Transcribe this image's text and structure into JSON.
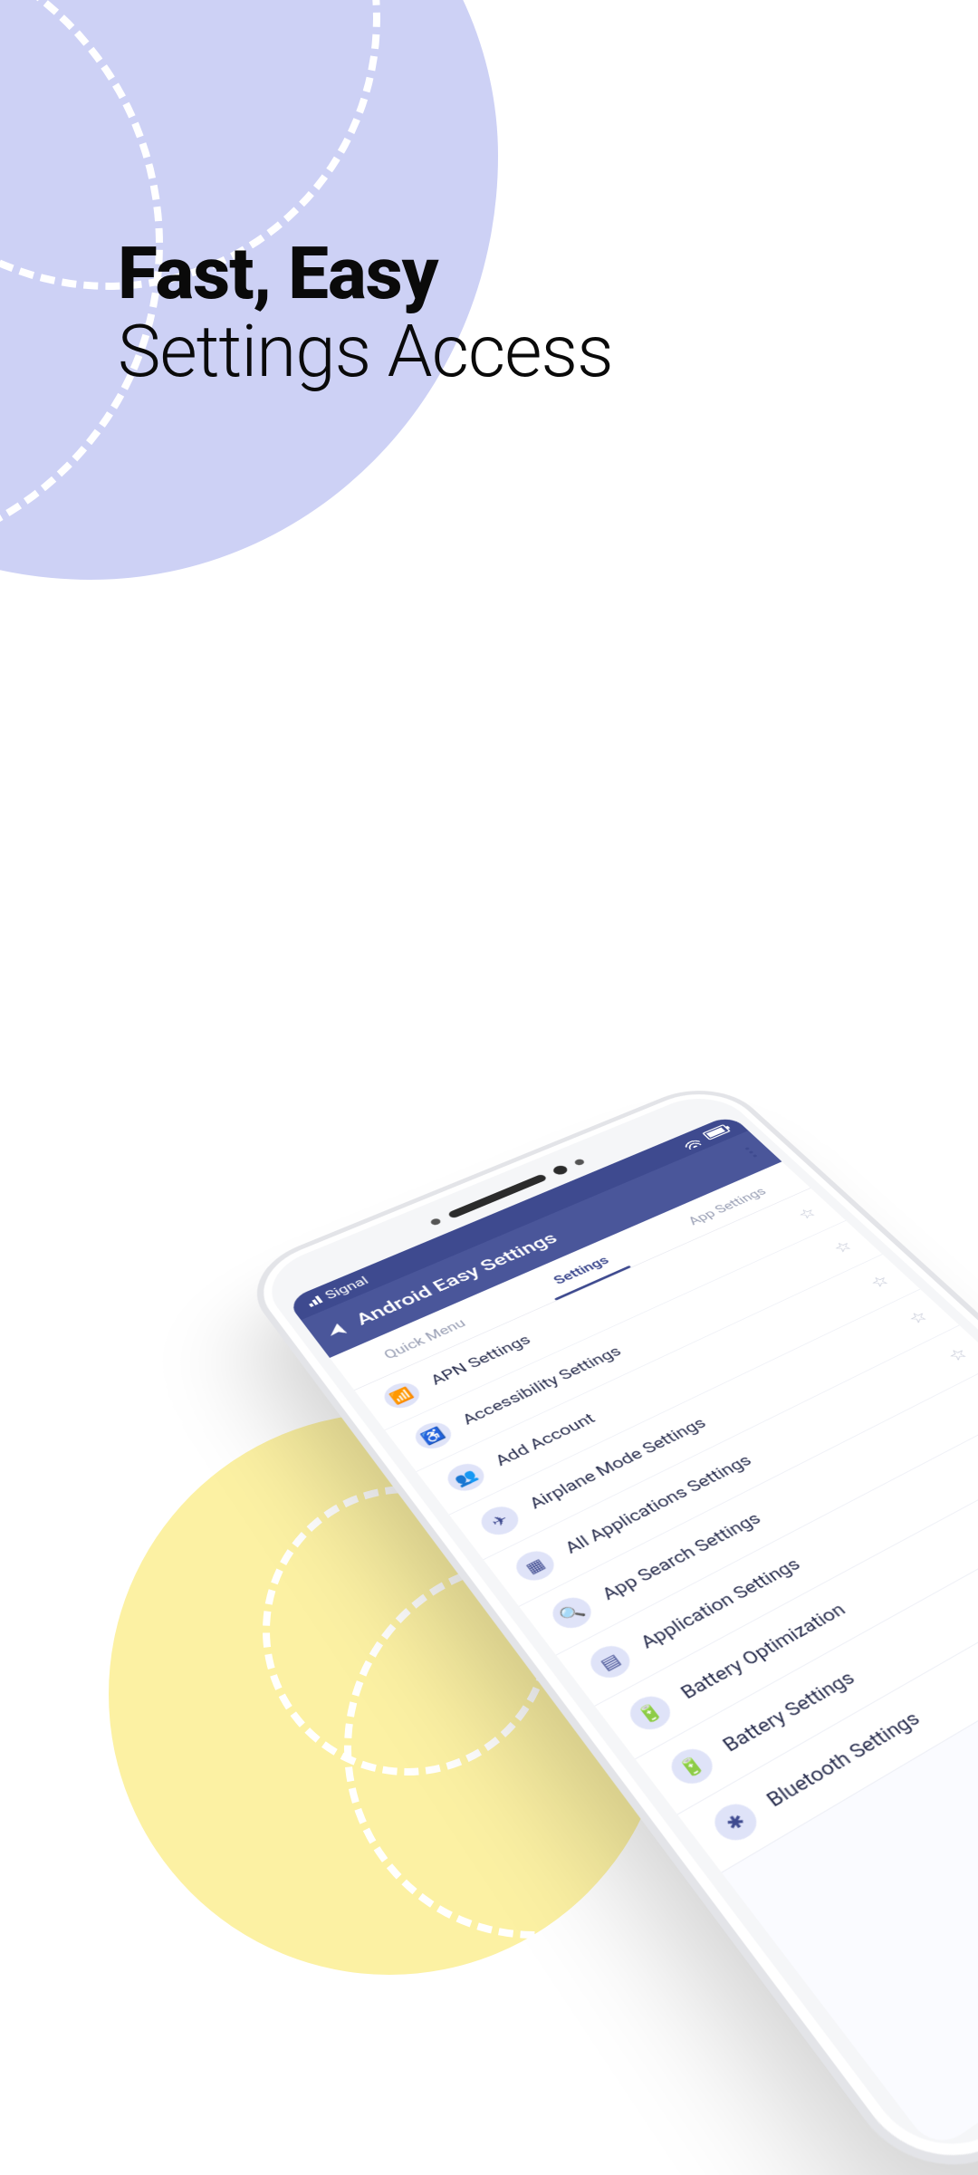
{
  "headline": {
    "bold": "Fast, Easy",
    "light": "Settings Access"
  },
  "status": {
    "signal_label": "Signal"
  },
  "appbar": {
    "title": "Android Easy Settings"
  },
  "tabs": [
    {
      "label": "Quick Menu",
      "active": false
    },
    {
      "label": "Settings",
      "active": true
    },
    {
      "label": "App Settings",
      "active": false
    }
  ],
  "settings_list": [
    {
      "icon": "📶",
      "label": "APN Settings"
    },
    {
      "icon": "♿",
      "label": "Accessibility Settings"
    },
    {
      "icon": "👥",
      "label": "Add Account"
    },
    {
      "icon": "✈",
      "label": "Airplane Mode Settings"
    },
    {
      "icon": "▦",
      "label": "All Applications Settings"
    },
    {
      "icon": "🔍",
      "label": "App Search Settings"
    },
    {
      "icon": "▤",
      "label": "Application Settings"
    },
    {
      "icon": "🔋",
      "label": "Battery Optimization"
    },
    {
      "icon": "🔋",
      "label": "Battery Settings"
    },
    {
      "icon": "✱",
      "label": "Bluetooth Settings"
    }
  ],
  "colors": {
    "accent": "#4a569a",
    "blob_purple": "#cdd1f5",
    "blob_yellow": "#fcf1a3"
  }
}
